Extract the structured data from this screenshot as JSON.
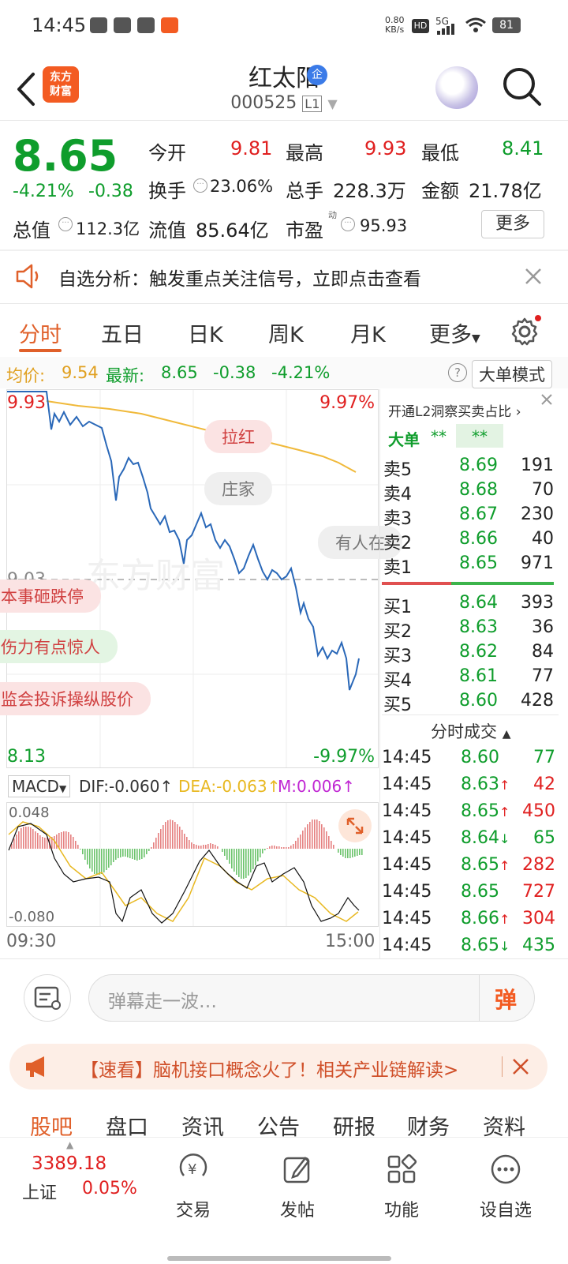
{
  "status_bar": {
    "time": "14:45",
    "network_speed": "0.80\nKB/s",
    "signal": "5G",
    "battery": "81"
  },
  "header": {
    "logo_text": "东方\n财富",
    "title": "红太阳",
    "verified_badge": "企",
    "code": "000525",
    "level": "L1"
  },
  "quote": {
    "price": "8.65",
    "change_pct": "-4.21%",
    "change": "-0.38",
    "open_label": "今开",
    "open": "9.81",
    "high_label": "最高",
    "high": "9.93",
    "low_label": "最低",
    "low": "8.41",
    "turnover_label": "换手",
    "turnover": "23.06%",
    "volume_label": "总手",
    "volume": "228.3万",
    "amount_label": "金额",
    "amount": "21.78亿",
    "mcap_label": "总值",
    "mcap": "112.3亿",
    "float_label": "流值",
    "float": "85.64亿",
    "pe_label": "市盈",
    "pe_sup": "动",
    "pe": "95.93",
    "more_label": "更多"
  },
  "notice": {
    "text": "自选分析：触发重点关注信号，立即点击查看"
  },
  "tabs": [
    {
      "label": "分时"
    },
    {
      "label": "五日"
    },
    {
      "label": "日K"
    },
    {
      "label": "周K"
    },
    {
      "label": "月K"
    },
    {
      "label": "更多"
    }
  ],
  "avg_row": {
    "avg_label": "均价:",
    "avg": "9.54",
    "latest_label": "最新:",
    "latest": "8.65",
    "chg": "-0.38",
    "chg_pct": "-4.21%",
    "big_order_mode": "大单模式"
  },
  "chart": {
    "high_label": "9.93",
    "high_pct": "9.97%",
    "mid_label": "9.03",
    "low_label": "8.13",
    "low_pct": "-9.97%",
    "time_start": "09:30",
    "time_end": "15:00",
    "watermark": "东方财富",
    "bubbles": [
      "拉红",
      "庄家",
      "有人在",
      "本事砸跌停",
      "伤力有点惊人",
      "监会投诉操纵股价"
    ]
  },
  "macd": {
    "label": "MACD",
    "dif": "DIF:-0.060",
    "dea": "DEA:-0.063",
    "m": "M:0.006",
    "top": "0.048",
    "bottom": "-0.080"
  },
  "order_book": {
    "l2_text": "开通L2洞察买卖占比",
    "big_label": "大单",
    "big_v1": "**",
    "big_v2": "**",
    "sells": [
      {
        "label": "卖5",
        "price": "8.69",
        "vol": "191"
      },
      {
        "label": "卖4",
        "price": "8.68",
        "vol": "70"
      },
      {
        "label": "卖3",
        "price": "8.67",
        "vol": "230"
      },
      {
        "label": "卖2",
        "price": "8.66",
        "vol": "40"
      },
      {
        "label": "卖1",
        "price": "8.65",
        "vol": "971"
      }
    ],
    "buys": [
      {
        "label": "买1",
        "price": "8.64",
        "vol": "393"
      },
      {
        "label": "买2",
        "price": "8.63",
        "vol": "36"
      },
      {
        "label": "买3",
        "price": "8.62",
        "vol": "84"
      },
      {
        "label": "买4",
        "price": "8.61",
        "vol": "77"
      },
      {
        "label": "买5",
        "price": "8.60",
        "vol": "428"
      }
    ],
    "trades_title": "分时成交",
    "trades": [
      {
        "time": "14:45",
        "price": "8.60",
        "dir": "",
        "vol": "77"
      },
      {
        "time": "14:45",
        "price": "8.63",
        "dir": "↑",
        "vol": "42"
      },
      {
        "time": "14:45",
        "price": "8.65",
        "dir": "↑",
        "vol": "450"
      },
      {
        "time": "14:45",
        "price": "8.64",
        "dir": "↓",
        "vol": "65"
      },
      {
        "time": "14:45",
        "price": "8.65",
        "dir": "↑",
        "vol": "282"
      },
      {
        "time": "14:45",
        "price": "8.65",
        "dir": "",
        "vol": "727"
      },
      {
        "time": "14:45",
        "price": "8.66",
        "dir": "↑",
        "vol": "304"
      },
      {
        "time": "14:45",
        "price": "8.65",
        "dir": "↓",
        "vol": "435"
      }
    ]
  },
  "danmu": {
    "placeholder": "弹幕走一波…",
    "send_label": "弹"
  },
  "ad": {
    "text": "【速看】脑机接口概念火了！相关产业链解读>"
  },
  "subtabs": [
    {
      "label": "股吧"
    },
    {
      "label": "盘口"
    },
    {
      "label": "资讯"
    },
    {
      "label": "公告"
    },
    {
      "label": "研报"
    },
    {
      "label": "财务"
    },
    {
      "label": "资料"
    }
  ],
  "bottom_bar": {
    "index_value": "3389.18",
    "index_name": "上证",
    "index_pct": "0.05%",
    "items": [
      {
        "label": "交易"
      },
      {
        "label": "发帖"
      },
      {
        "label": "功能"
      },
      {
        "label": "设自选"
      }
    ]
  },
  "colors": {
    "up": "#e02020",
    "down": "#0f9d2c",
    "accent": "#e0602a",
    "avg_line": "#f0b93a",
    "price_line": "#2a68b8"
  }
}
